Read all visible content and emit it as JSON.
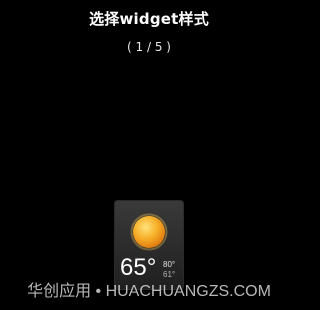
{
  "header": {
    "title": "选择widget样式",
    "page_indicator": "( 1 / 5 )"
  },
  "widget": {
    "icon": "sun-icon",
    "temperature": "65°",
    "high": "80°",
    "low": "61°"
  },
  "watermark": "华创应用 • HUACHUANGZS.COM",
  "colors": {
    "background": "#000000",
    "sun": "#f5a623"
  }
}
